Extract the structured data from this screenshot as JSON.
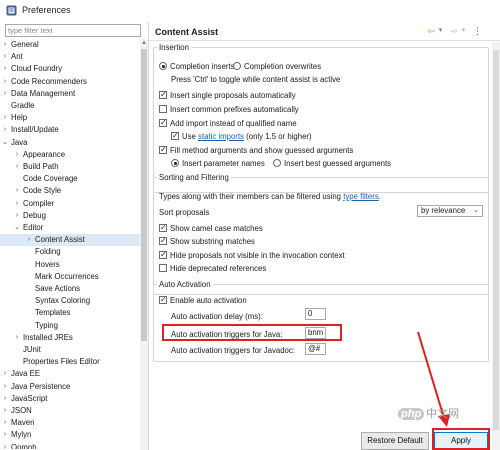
{
  "window": {
    "title": "Preferences"
  },
  "tree": {
    "filter_placeholder": "type filter text",
    "items": [
      {
        "label": "General",
        "twisty": "›"
      },
      {
        "label": "Ant",
        "twisty": "›"
      },
      {
        "label": "Cloud Foundry",
        "twisty": "›"
      },
      {
        "label": "Code Recommenders",
        "twisty": "›"
      },
      {
        "label": "Data Management",
        "twisty": "›"
      },
      {
        "label": "Gradle",
        "twisty": ""
      },
      {
        "label": "Help",
        "twisty": "›"
      },
      {
        "label": "Install/Update",
        "twisty": "›"
      },
      {
        "label": "Java",
        "twisty": "⌄"
      },
      {
        "label": "Appearance",
        "twisty": "›"
      },
      {
        "label": "Build Path",
        "twisty": "›"
      },
      {
        "label": "Code Coverage",
        "twisty": ""
      },
      {
        "label": "Code Style",
        "twisty": "›"
      },
      {
        "label": "Compiler",
        "twisty": "›"
      },
      {
        "label": "Debug",
        "twisty": "›"
      },
      {
        "label": "Editor",
        "twisty": "⌄"
      },
      {
        "label": "Content Assist",
        "twisty": "›"
      },
      {
        "label": "Folding",
        "twisty": ""
      },
      {
        "label": "Hovers",
        "twisty": ""
      },
      {
        "label": "Mark Occurrences",
        "twisty": ""
      },
      {
        "label": "Save Actions",
        "twisty": ""
      },
      {
        "label": "Syntax Coloring",
        "twisty": ""
      },
      {
        "label": "Templates",
        "twisty": ""
      },
      {
        "label": "Typing",
        "twisty": ""
      },
      {
        "label": "Installed JREs",
        "twisty": "›"
      },
      {
        "label": "JUnit",
        "twisty": ""
      },
      {
        "label": "Properties Files Editor",
        "twisty": ""
      },
      {
        "label": "Java EE",
        "twisty": "›"
      },
      {
        "label": "Java Persistence",
        "twisty": "›"
      },
      {
        "label": "JavaScript",
        "twisty": "›"
      },
      {
        "label": "JSON",
        "twisty": "›"
      },
      {
        "label": "Maven",
        "twisty": "›"
      },
      {
        "label": "Mylyn",
        "twisty": "›"
      },
      {
        "label": "Oomph",
        "twisty": "›"
      }
    ],
    "selected_label": "Content Assist"
  },
  "page": {
    "title": "Content Assist",
    "nav": {
      "back": "⇦",
      "back_menu": "▾",
      "forward": "⇨",
      "forward_menu": "▾",
      "menu": "⋮"
    }
  },
  "insertion": {
    "legend": "Insertion",
    "radio_inserts": "Completion inserts",
    "radio_overwrites": "Completion overwrites",
    "toggle_hint": "Press 'Ctrl' to toggle while content assist is active",
    "cb_single": "Insert single proposals automatically",
    "cb_prefixes": "Insert common prefixes automatically",
    "cb_import": "Add import instead of qualified name",
    "cb_static_pre": "Use",
    "cb_static_link": "static imports",
    "cb_static_post": "(only 1.5 or higher)",
    "cb_fill": "Fill method arguments and show guessed arguments",
    "radio_param_names": "Insert parameter names",
    "radio_best_guess": "Insert best guessed arguments"
  },
  "sorting": {
    "legend": "Sorting and Filtering",
    "types_pre": "Types along with their members can be filtered using",
    "types_link": "type filters",
    "types_post": ".",
    "sort_label": "Sort proposals",
    "sort_value": "by relevance",
    "cb_camel": "Show camel case matches",
    "cb_substring": "Show substring matches",
    "cb_hide_invocation": "Hide proposals not visible in the invocation context",
    "cb_hide_deprecated": "Hide deprecated references"
  },
  "auto_activation": {
    "legend": "Auto Activation",
    "cb_enable": "Enable auto activation",
    "delay_label": "Auto activation delay (ms):",
    "delay_value": "0",
    "java_label": "Auto activation triggers for Java:",
    "java_value": "bnm",
    "javadoc_label": "Auto activation triggers for Javadoc:",
    "javadoc_value": "@#"
  },
  "buttons": {
    "restore": "Restore Default",
    "apply": "Apply"
  },
  "watermark": {
    "logo": "php",
    "text": "中文网"
  },
  "colors": {
    "highlight": "#e02020",
    "link": "#1a5fb4",
    "selection": "#dbe9f7"
  }
}
